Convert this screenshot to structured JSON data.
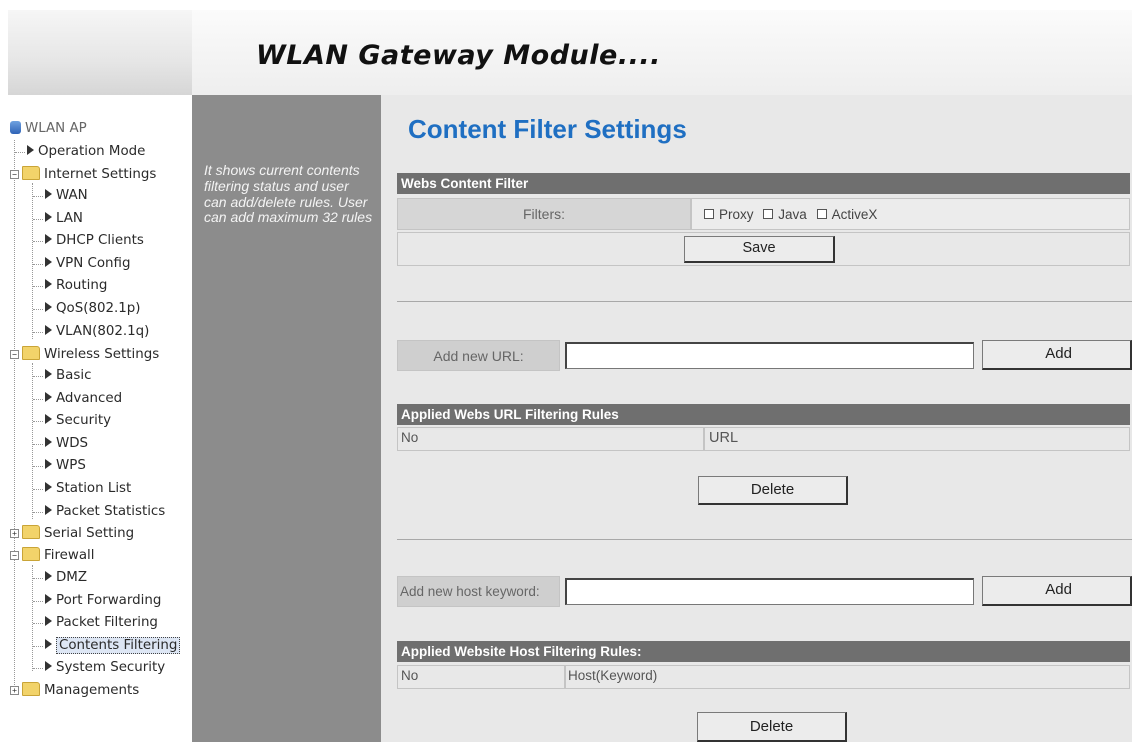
{
  "header": {
    "title": "WLAN Gateway Module...."
  },
  "tree": {
    "root": "WLAN AP",
    "items": [
      {
        "label": "Operation Mode"
      },
      {
        "label": "Internet Settings"
      },
      {
        "label": "WAN"
      },
      {
        "label": "LAN"
      },
      {
        "label": "DHCP Clients"
      },
      {
        "label": "VPN Config"
      },
      {
        "label": "Routing"
      },
      {
        "label": "QoS(802.1p)"
      },
      {
        "label": "VLAN(802.1q)"
      },
      {
        "label": "Wireless Settings"
      },
      {
        "label": "Basic"
      },
      {
        "label": "Advanced"
      },
      {
        "label": "Security"
      },
      {
        "label": "WDS"
      },
      {
        "label": "WPS"
      },
      {
        "label": "Station List"
      },
      {
        "label": "Packet Statistics"
      },
      {
        "label": "Serial Setting"
      },
      {
        "label": "Firewall"
      },
      {
        "label": "DMZ"
      },
      {
        "label": "Port Forwarding"
      },
      {
        "label": "Packet Filtering"
      },
      {
        "label": "Contents Filtering"
      },
      {
        "label": "System Security"
      },
      {
        "label": "Managements"
      }
    ]
  },
  "info": {
    "text": "It shows current contents filtering status and user can add/delete rules. User can add maximum 32 rules"
  },
  "main": {
    "title": "Content Filter Settings",
    "webs_filter": {
      "heading": "Webs Content Filter",
      "filters_label": "Filters:",
      "options": [
        "Proxy",
        "Java",
        "ActiveX"
      ],
      "save_label": "Save"
    },
    "add_url": {
      "label": "Add new URL:",
      "value": "",
      "button": "Add"
    },
    "url_rules": {
      "heading": "Applied Webs URL Filtering Rules",
      "columns": [
        "No",
        "URL"
      ],
      "delete_label": "Delete"
    },
    "add_host": {
      "label": "Add new host keyword:",
      "value": "",
      "button": "Add"
    },
    "host_rules": {
      "heading": "Applied Website Host Filtering Rules:",
      "columns": [
        "No",
        "Host(Keyword)"
      ],
      "delete_label": "Delete"
    }
  },
  "colors": {
    "accent": "#1f6fc2",
    "section_header": "#6f6f6f",
    "info_panel": "#8c8c8c",
    "main_bg": "#e8e8e8"
  }
}
